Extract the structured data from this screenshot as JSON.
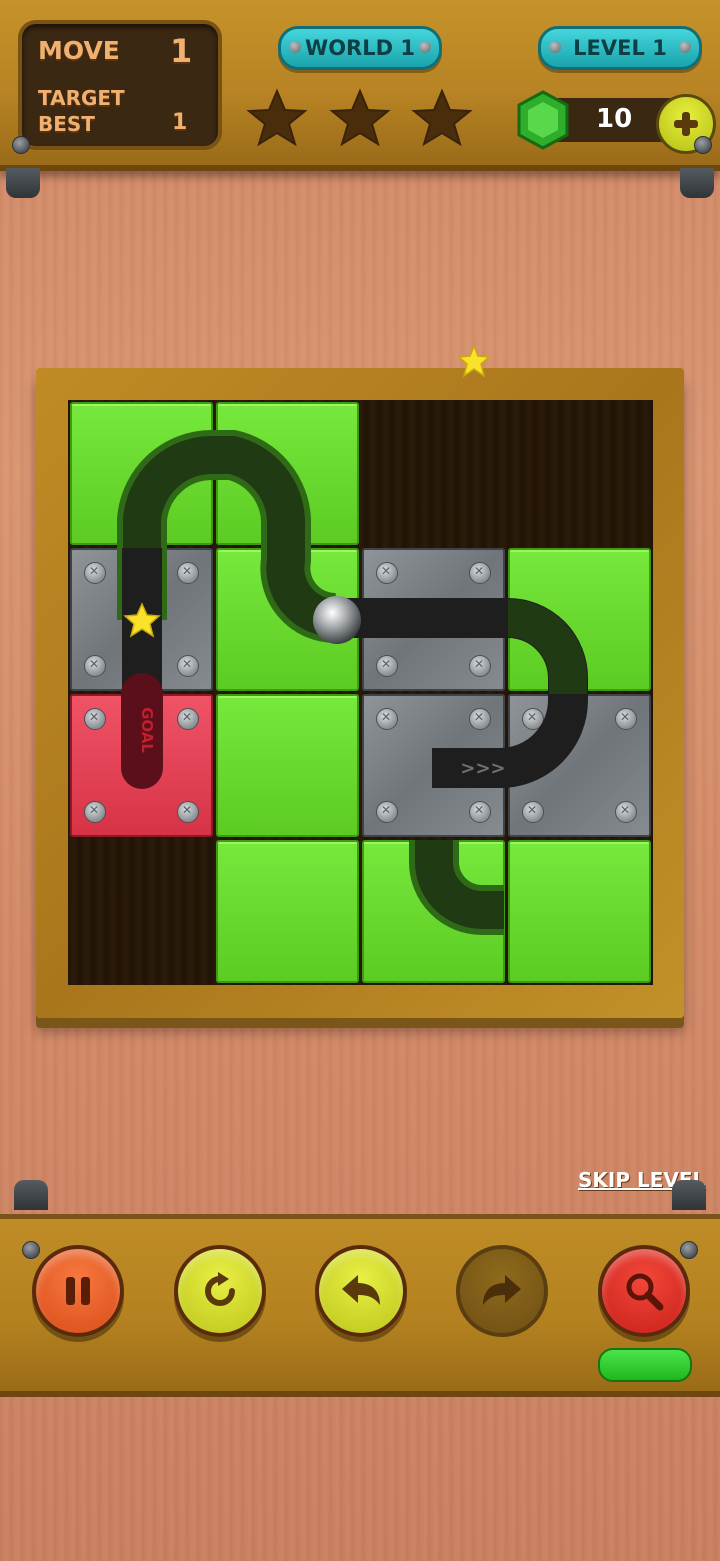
{
  "hud": {
    "move_label": "MOVE",
    "move_value": "1",
    "target_label": "TARGET",
    "best_label": "BEST",
    "best_value": "1",
    "world_label": "WORLD 1",
    "level_label": "LEVEL 1",
    "gems": "10",
    "stars_earned": 0,
    "stars_total": 3
  },
  "board": {
    "grid": "4x4",
    "tiles": [
      {
        "row": 0,
        "col": 0,
        "type": "green",
        "path": "curve"
      },
      {
        "row": 0,
        "col": 1,
        "type": "green",
        "path": "curve"
      },
      {
        "row": 0,
        "col": 2,
        "type": "empty"
      },
      {
        "row": 0,
        "col": 3,
        "type": "empty"
      },
      {
        "row": 1,
        "col": 0,
        "type": "metal",
        "path": "straight-vertical"
      },
      {
        "row": 1,
        "col": 1,
        "type": "green",
        "path": "curve"
      },
      {
        "row": 1,
        "col": 2,
        "type": "metal",
        "path": "straight-horizontal"
      },
      {
        "row": 1,
        "col": 3,
        "type": "green",
        "path": "curve"
      },
      {
        "row": 2,
        "col": 0,
        "type": "red",
        "path": "goal"
      },
      {
        "row": 2,
        "col": 1,
        "type": "green",
        "path": "none"
      },
      {
        "row": 2,
        "col": 2,
        "type": "metal",
        "path": "start"
      },
      {
        "row": 2,
        "col": 3,
        "type": "metal",
        "path": "curve"
      },
      {
        "row": 3,
        "col": 0,
        "type": "empty"
      },
      {
        "row": 3,
        "col": 1,
        "type": "green",
        "path": "none"
      },
      {
        "row": 3,
        "col": 2,
        "type": "green",
        "path": "curve"
      },
      {
        "row": 3,
        "col": 3,
        "type": "green",
        "path": "none"
      }
    ],
    "goal_label": "GOAL",
    "arrow_text": ">>>"
  },
  "controls": {
    "skip_label": "SKIP LEVEL",
    "buttons": [
      "pause",
      "restart",
      "undo",
      "redo",
      "hint"
    ]
  },
  "colors": {
    "wood_bar": "#b88424",
    "tile_green": "#66d62d",
    "tile_metal": "#7b8085",
    "goal_red": "#e03e52",
    "pill_cyan": "#2cbcc4"
  }
}
